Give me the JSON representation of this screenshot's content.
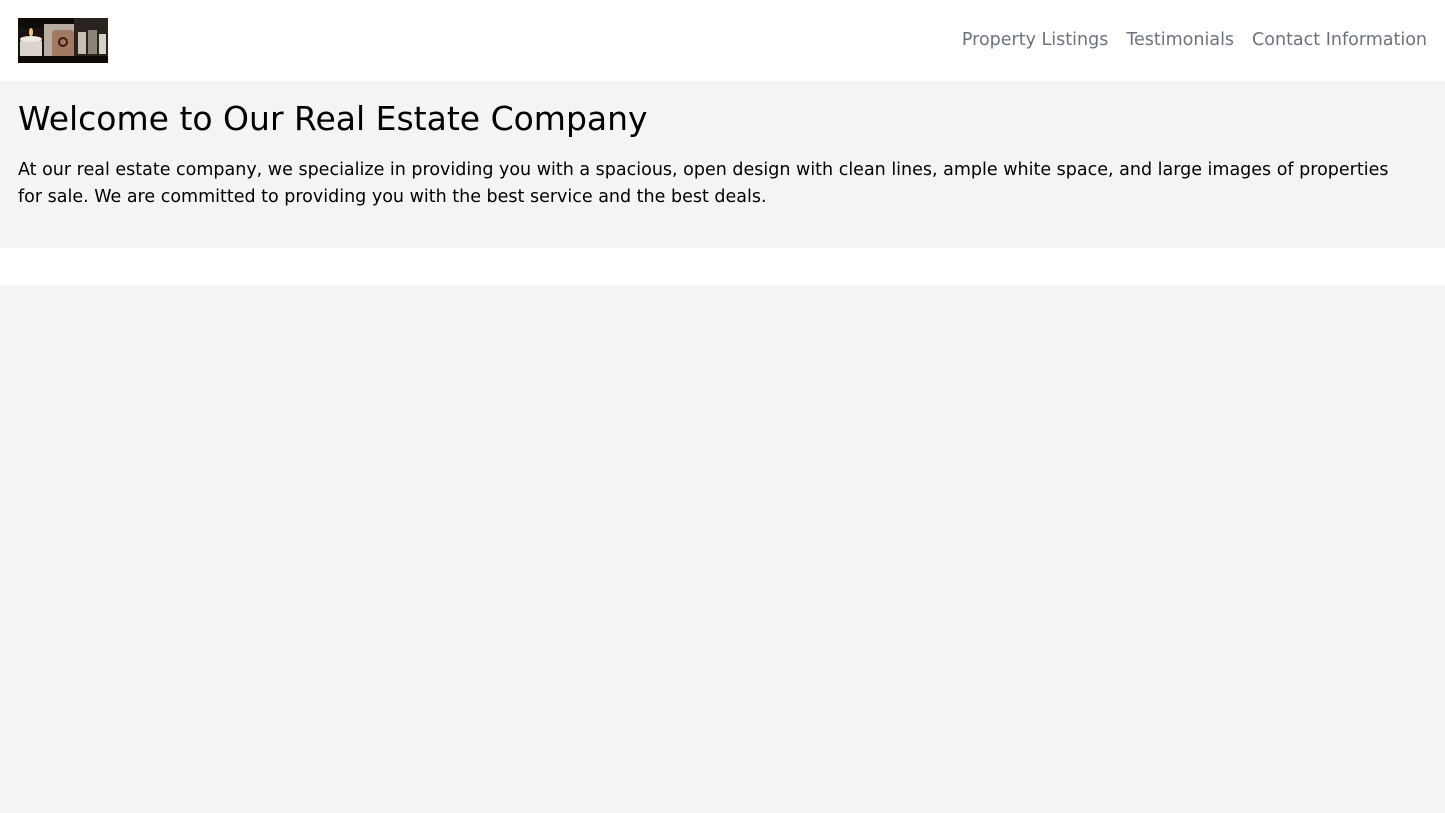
{
  "header": {
    "logo_icon": "candle-photo-logo",
    "nav": [
      {
        "label": "Property Listings"
      },
      {
        "label": "Testimonials"
      },
      {
        "label": "Contact Information"
      }
    ]
  },
  "hero": {
    "title": "Welcome to Our Real Estate Company",
    "description": "At our real estate company, we specialize in providing you with a spacious, open design with clean lines, ample white space, and large images of properties for sale. We are committed to providing you with the best service and the best deals."
  },
  "colors": {
    "header_bg": "#ffffff",
    "page_bg": "#f3f4f6",
    "nav_text": "#6b7280",
    "body_text": "#000000"
  }
}
